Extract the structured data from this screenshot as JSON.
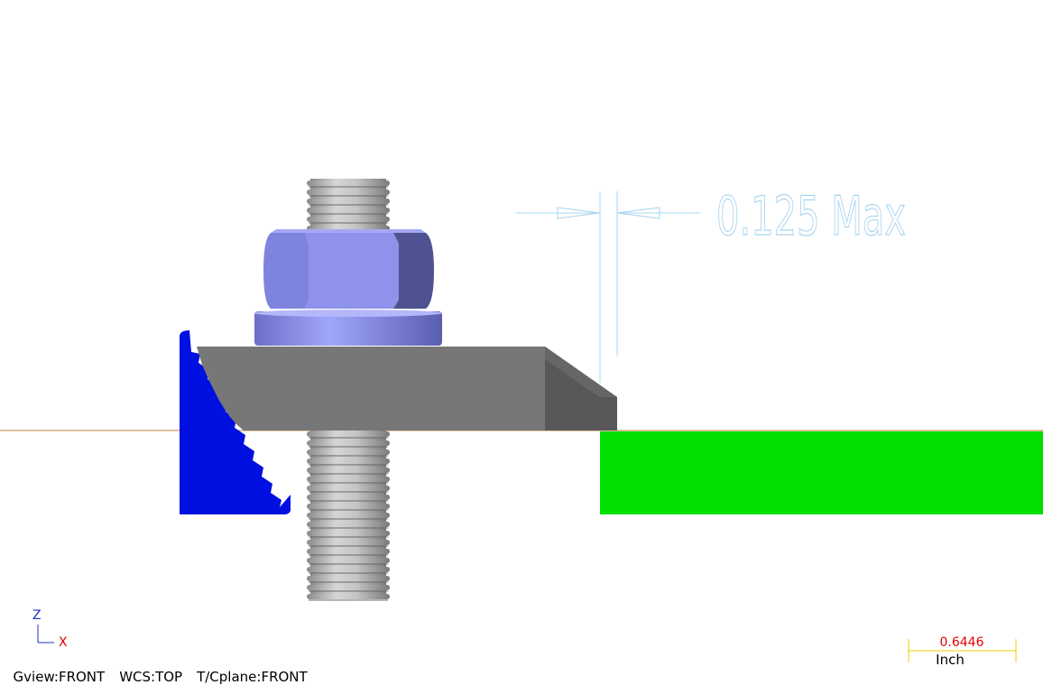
{
  "annotation": {
    "dimension_text": "0.125 Max"
  },
  "status": {
    "gview": "Gview:FRONT",
    "wcs": "WCS:TOP",
    "tcplane": "T/Cplane:FRONT"
  },
  "axes": {
    "z_label": "Z",
    "x_label": "X"
  },
  "scale": {
    "value": "0.6446",
    "unit": "Inch"
  },
  "colors": {
    "nut": "#8a8fe8",
    "clamp": "#787878",
    "jaw": "#0010e0",
    "stock": "#00e000",
    "bolt": "#b0b0b0",
    "dimension": "#a8d4f0",
    "origin_line": "#c08040"
  }
}
